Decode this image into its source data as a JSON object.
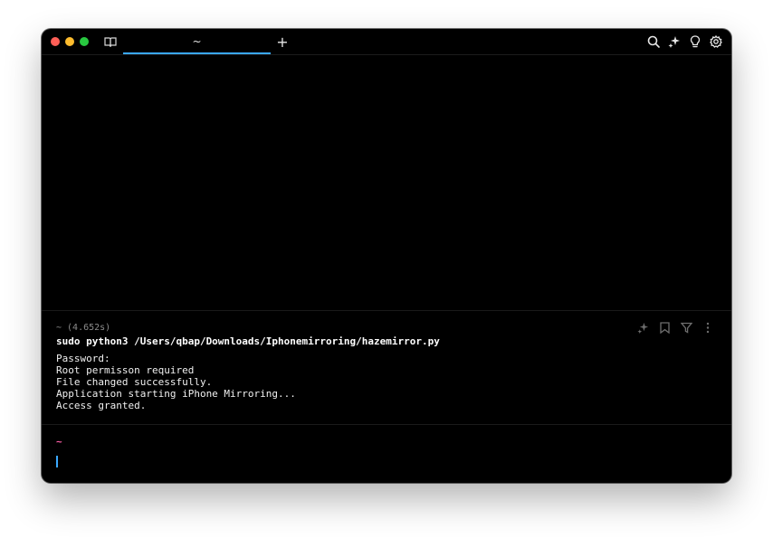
{
  "window": {
    "tab_title": "~",
    "new_tab_label": "+"
  },
  "toolbar": {
    "icons": [
      "search-icon",
      "ai-sparkle-icon",
      "lightbulb-icon",
      "settings-gear-icon"
    ]
  },
  "block": {
    "meta": "~ (4.652s)",
    "command": "sudo python3 /Users/qbap/Downloads/Iphonemirroring/hazemirror.py",
    "output": [
      "Password:",
      "Root permisson required",
      "File changed successfully.",
      "Application starting iPhone Mirroring...",
      "Access granted."
    ],
    "actions": [
      "ai-sparkle-icon",
      "bookmark-icon",
      "filter-icon",
      "more-vertical-icon"
    ]
  },
  "prompt": {
    "symbol": "~"
  },
  "colors": {
    "background": "#000000",
    "accent": "#3aa8ff",
    "prompt": "#ff5fa8",
    "meta_text": "#8c8c8c"
  }
}
